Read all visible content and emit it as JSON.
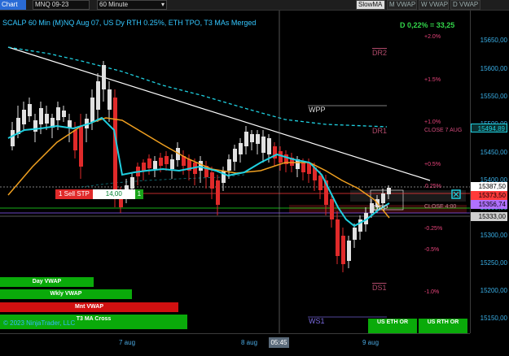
{
  "toolbar": {
    "tab_label": "Chart",
    "instrument": "MNQ 09-23",
    "timeframe": "60 Minute",
    "indicator_buttons": [
      {
        "label": "SlowMA",
        "active": true
      },
      {
        "label": "M VWAP",
        "active": false
      },
      {
        "label": "W VWAP",
        "active": false
      },
      {
        "label": "D VWAP",
        "active": false
      }
    ]
  },
  "chart_title": "SCALP 60 Min (M)NQ Aug 07, US Dy RTH 0.25%, ETH TPO, T3 MAs Merged",
  "performance": "D 0,22% = 33,25",
  "percent_levels": [
    "+2.0%",
    "+1.5%",
    "+1.0%",
    "+0.5%",
    "0.25%",
    "-0.25%",
    "-0.5%",
    "-1.0%"
  ],
  "levels": {
    "dr2": "DR2",
    "dr1": "DR1",
    "wpp": "WPP",
    "dpp": "DPP",
    "ds1": "DS1",
    "ws1": "WS1",
    "close7": "CLOSE 7 AUG",
    "close_ib": "CLOSE 4:00"
  },
  "price_axis": {
    "ticks": [
      "15650,00",
      "15600,00",
      "15550,00",
      "15500,00",
      "15450,00",
      "15400,00",
      "15350,00",
      "15300,00",
      "15250,00",
      "15200,00",
      "15150,00"
    ],
    "boxes": [
      {
        "label": "15494,89",
        "color": "#1fd0e0"
      },
      {
        "label": "15387,50",
        "color": "#ffffff"
      },
      {
        "label": "15373,50",
        "color": "#ff3a3a"
      },
      {
        "label": "15356,74",
        "color": "#b070ff"
      },
      {
        "label": "15333,00",
        "color": "#cfcfcf"
      }
    ]
  },
  "time_axis": {
    "labels": [
      "7 aug",
      "8 aug",
      "9 aug"
    ],
    "cursor_time": "05:45"
  },
  "sell_order": {
    "label": "1 Sell STP",
    "price": "14,00",
    "count": "1"
  },
  "signals": [
    {
      "label": "Day VWAP",
      "color": "#0aaa0a"
    },
    {
      "label": "Wkly VWAP",
      "color": "#0aaa0a"
    },
    {
      "label": "Mnt VWAP",
      "color": "#d01010"
    },
    {
      "label": "T3 MA Cross",
      "color": "#0aaa0a"
    }
  ],
  "order_buttons": [
    {
      "line1": "US ETH OR",
      "line2": "—"
    },
    {
      "line1": "US RTH OR",
      "line2": "—"
    }
  ],
  "copyright": "© 2023 NinjaTrader, LLC"
}
